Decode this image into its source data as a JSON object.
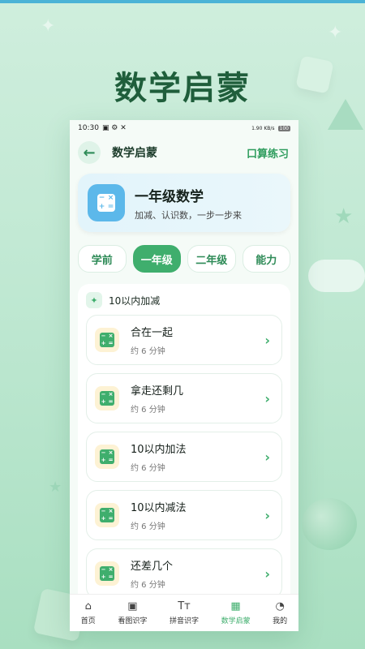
{
  "headline": "数学启蒙",
  "status": {
    "time": "10:30",
    "net": "1.90 KB/s",
    "battery": "100"
  },
  "appbar": {
    "title": "数学启蒙",
    "action": "口算练习"
  },
  "hero": {
    "title": "一年级数学",
    "subtitle": "加减、认识数，一步一步来"
  },
  "tabs": [
    "学前",
    "一年级",
    "二年级",
    "能力"
  ],
  "section": {
    "title": "10以内加减"
  },
  "lessons": [
    {
      "title": "合在一起",
      "meta": "约 6 分钟"
    },
    {
      "title": "拿走还剩几",
      "meta": "约 6 分钟"
    },
    {
      "title": "10以内加法",
      "meta": "约 6 分钟"
    },
    {
      "title": "10以内减法",
      "meta": "约 6 分钟"
    },
    {
      "title": "还差几个",
      "meta": "约 6 分钟"
    }
  ],
  "nav": [
    {
      "label": "首页",
      "icon": "home-icon"
    },
    {
      "label": "看图识字",
      "icon": "image-icon"
    },
    {
      "label": "拼音识字",
      "icon": "text-icon"
    },
    {
      "label": "数学启蒙",
      "icon": "calculator-icon"
    },
    {
      "label": "我的",
      "icon": "person-icon"
    }
  ],
  "colors": {
    "accent": "#3fae6d",
    "hero_icon": "#5cb8ea"
  }
}
